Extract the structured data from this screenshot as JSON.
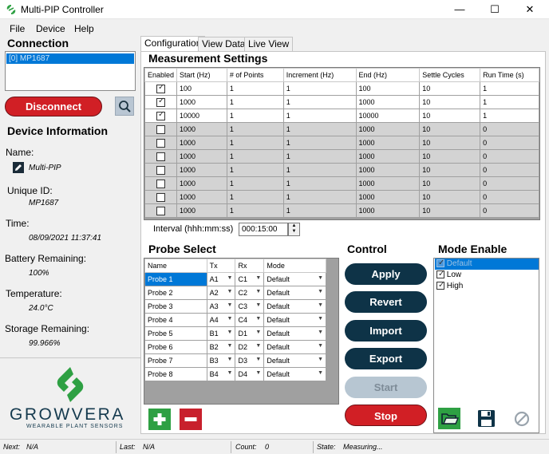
{
  "window": {
    "title": "Multi-PIP Controller"
  },
  "menu": {
    "items": [
      "File",
      "Device",
      "Help"
    ]
  },
  "connection": {
    "title": "Connection",
    "selected_device": "[0] MP1687",
    "disconnect_label": "Disconnect"
  },
  "device_info": {
    "title": "Device Information",
    "name_label": "Name:",
    "name_value": "Multi-PIP",
    "uid_label": "Unique ID:",
    "uid_value": "MP1687",
    "time_label": "Time:",
    "time_value": "08/09/2021 11:37:41",
    "battery_label": "Battery Remaining:",
    "battery_value": "100%",
    "temp_label": "Temperature:",
    "temp_value": "24.0°C",
    "storage_label": "Storage Remaining:",
    "storage_value": "99.966%"
  },
  "logo": {
    "name": "GROWVERA",
    "tagline": "WEARABLE PLANT SENSORS"
  },
  "tabs": [
    "Configuration",
    "View Data",
    "Live View"
  ],
  "measurement": {
    "title": "Measurement Settings",
    "columns": [
      "Enabled",
      "Start (Hz)",
      "# of Points",
      "Increment (Hz)",
      "End (Hz)",
      "Settle Cycles",
      "Run Time (s)"
    ],
    "rows": [
      {
        "enabled": true,
        "start": "100",
        "points": "1",
        "inc": "1",
        "end": "100",
        "settle": "10",
        "run": "1"
      },
      {
        "enabled": true,
        "start": "1000",
        "points": "1",
        "inc": "1",
        "end": "1000",
        "settle": "10",
        "run": "1"
      },
      {
        "enabled": true,
        "start": "10000",
        "points": "1",
        "inc": "1",
        "end": "10000",
        "settle": "10",
        "run": "1"
      },
      {
        "enabled": false,
        "start": "1000",
        "points": "1",
        "inc": "1",
        "end": "1000",
        "settle": "10",
        "run": "0"
      },
      {
        "enabled": false,
        "start": "1000",
        "points": "1",
        "inc": "1",
        "end": "1000",
        "settle": "10",
        "run": "0"
      },
      {
        "enabled": false,
        "start": "1000",
        "points": "1",
        "inc": "1",
        "end": "1000",
        "settle": "10",
        "run": "0"
      },
      {
        "enabled": false,
        "start": "1000",
        "points": "1",
        "inc": "1",
        "end": "1000",
        "settle": "10",
        "run": "0"
      },
      {
        "enabled": false,
        "start": "1000",
        "points": "1",
        "inc": "1",
        "end": "1000",
        "settle": "10",
        "run": "0"
      },
      {
        "enabled": false,
        "start": "1000",
        "points": "1",
        "inc": "1",
        "end": "1000",
        "settle": "10",
        "run": "0"
      },
      {
        "enabled": false,
        "start": "1000",
        "points": "1",
        "inc": "1",
        "end": "1000",
        "settle": "10",
        "run": "0"
      }
    ],
    "interval_label": "Interval (hhh:mm:ss)",
    "interval_value": "000:15:00"
  },
  "probe_select": {
    "title": "Probe Select",
    "columns": [
      "Name",
      "Tx",
      "Rx",
      "Mode"
    ],
    "rows": [
      {
        "name": "Probe 1",
        "tx": "A1",
        "rx": "C1",
        "mode": "Default"
      },
      {
        "name": "Probe 2",
        "tx": "A2",
        "rx": "C2",
        "mode": "Default"
      },
      {
        "name": "Probe 3",
        "tx": "A3",
        "rx": "C3",
        "mode": "Default"
      },
      {
        "name": "Probe 4",
        "tx": "A4",
        "rx": "C4",
        "mode": "Default"
      },
      {
        "name": "Probe 5",
        "tx": "B1",
        "rx": "D1",
        "mode": "Default"
      },
      {
        "name": "Probe 6",
        "tx": "B2",
        "rx": "D2",
        "mode": "Default"
      },
      {
        "name": "Probe 7",
        "tx": "B3",
        "rx": "D3",
        "mode": "Default"
      },
      {
        "name": "Probe 8",
        "tx": "B4",
        "rx": "D4",
        "mode": "Default"
      }
    ]
  },
  "control": {
    "title": "Control",
    "apply": "Apply",
    "revert": "Revert",
    "import": "Import",
    "export": "Export",
    "start": "Start",
    "stop": "Stop"
  },
  "mode_enable": {
    "title": "Mode Enable",
    "modes": [
      {
        "label": "Default",
        "checked": true
      },
      {
        "label": "Low",
        "checked": true
      },
      {
        "label": "High",
        "checked": true
      }
    ]
  },
  "status": {
    "next_label": "Next:",
    "next_value": "N/A",
    "last_label": "Last:",
    "last_value": "N/A",
    "count_label": "Count:",
    "count_value": "0",
    "state_label": "State:",
    "state_value": "Measuring..."
  },
  "colors": {
    "accent": "#0078d7",
    "danger": "#d11f25",
    "navy": "#0e3347",
    "brand_green": "#2ea043"
  }
}
